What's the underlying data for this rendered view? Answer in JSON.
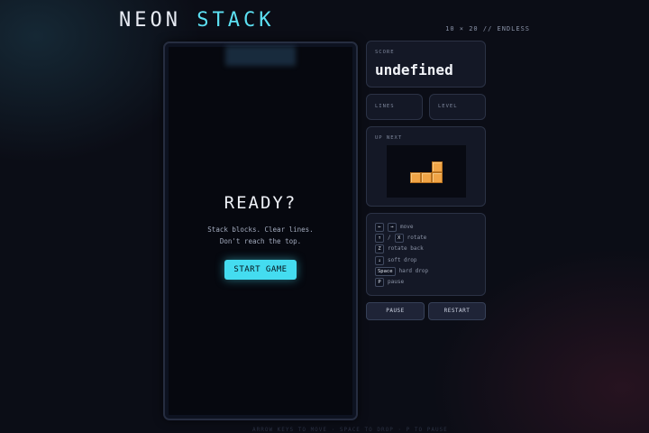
{
  "header": {
    "title_part1": "NEON",
    "title_part2": "STACK",
    "mode": "10 × 20 // ENDLESS"
  },
  "overlay": {
    "heading": "READY?",
    "line1": "Stack blocks. Clear lines.",
    "line2": "Don't reach the top.",
    "start_label": "START GAME"
  },
  "score": {
    "label": "SCORE",
    "value": "undefined"
  },
  "lines": {
    "label": "LINES"
  },
  "level": {
    "label": "LEVEL"
  },
  "next": {
    "label": "UP NEXT",
    "piece": "L",
    "color": "#f0a446"
  },
  "controls": [
    {
      "keys": [
        "←",
        "→"
      ],
      "sep": "",
      "action": "move"
    },
    {
      "keys": [
        "↑",
        "X"
      ],
      "sep": "/",
      "action": "rotate"
    },
    {
      "keys": [
        "Z"
      ],
      "sep": "",
      "action": "rotate back"
    },
    {
      "keys": [
        "↓"
      ],
      "sep": "",
      "action": "soft drop"
    },
    {
      "keys": [
        "Space"
      ],
      "sep": "",
      "action": "hard drop"
    },
    {
      "keys": [
        "P"
      ],
      "sep": "",
      "action": "pause"
    }
  ],
  "buttons": {
    "pause": "PAUSE",
    "restart": "RESTART"
  },
  "footer": "ARROW KEYS TO MOVE · SPACE TO DROP · P TO PAUSE",
  "colors": {
    "accent": "#5ce0f2",
    "background": "#0b0d16",
    "piece": "#f0a446"
  }
}
